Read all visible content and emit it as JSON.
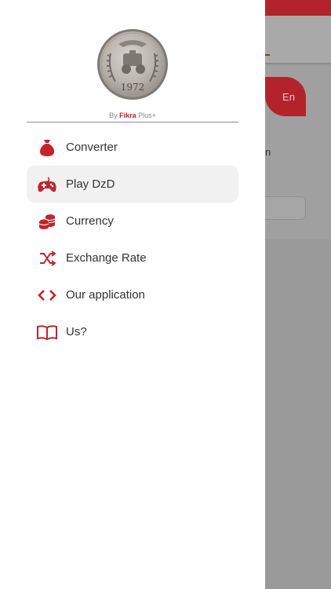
{
  "background": {
    "lang_button": "En",
    "text_fragment": "n"
  },
  "drawer": {
    "logo": {
      "coin_year": "1972"
    },
    "byline": {
      "prefix": "By",
      "brand": "Fikra",
      "suffix": "Plus+"
    },
    "menu": [
      {
        "label": "Converter",
        "icon": "money-bag-icon",
        "active": false
      },
      {
        "label": "Play DzD",
        "icon": "gamepad-icon",
        "active": true
      },
      {
        "label": "Currency",
        "icon": "coin-stack-icon",
        "active": false
      },
      {
        "label": "Exchange Rate",
        "icon": "shuffle-icon",
        "active": false
      },
      {
        "label": "Our application",
        "icon": "code-icon",
        "active": false
      },
      {
        "label": "Us?",
        "icon": "book-icon",
        "active": false
      }
    ]
  },
  "colors": {
    "accent": "#c3242c",
    "overlay": "#9a9a9a",
    "active_bg": "#f1f1f1"
  }
}
